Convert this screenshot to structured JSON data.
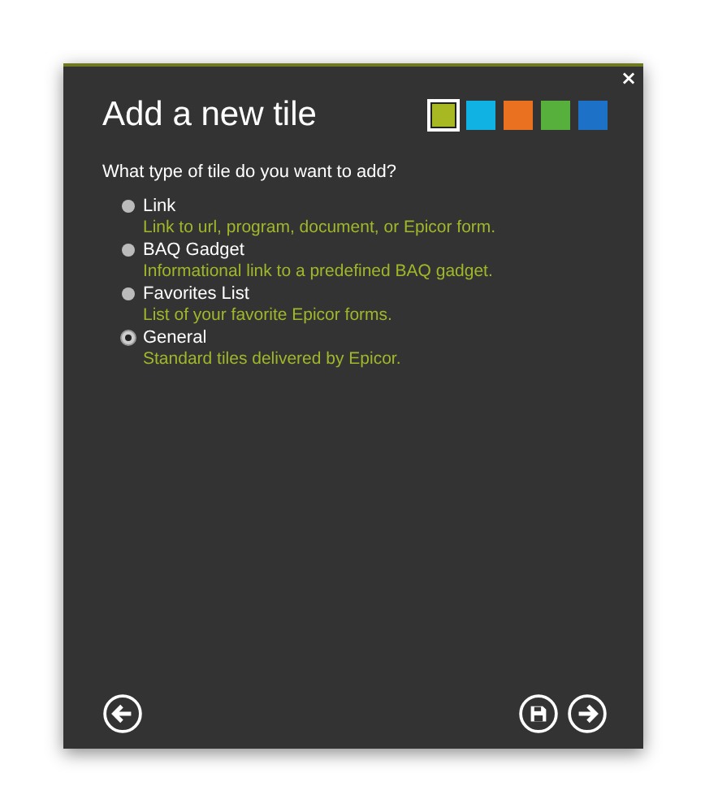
{
  "dialog": {
    "close": "×",
    "title": "Add a new tile",
    "swatches": [
      {
        "color": "#a8b823",
        "selected": true
      },
      {
        "color": "#0fb2e2",
        "selected": false
      },
      {
        "color": "#ea7120",
        "selected": false
      },
      {
        "color": "#57b03b",
        "selected": false
      },
      {
        "color": "#1d72c8",
        "selected": false
      }
    ],
    "question": "What type of tile do you want to add?",
    "options": [
      {
        "label": "Link",
        "description": "Link to url, program, document, or Epicor form.",
        "selected": false
      },
      {
        "label": "BAQ Gadget",
        "description": "Informational link to a predefined BAQ gadget.",
        "selected": false
      },
      {
        "label": "Favorites List",
        "description": "List of your favorite Epicor forms.",
        "selected": false
      },
      {
        "label": "General",
        "description": "Standard tiles delivered by Epicor.",
        "selected": true
      }
    ]
  }
}
